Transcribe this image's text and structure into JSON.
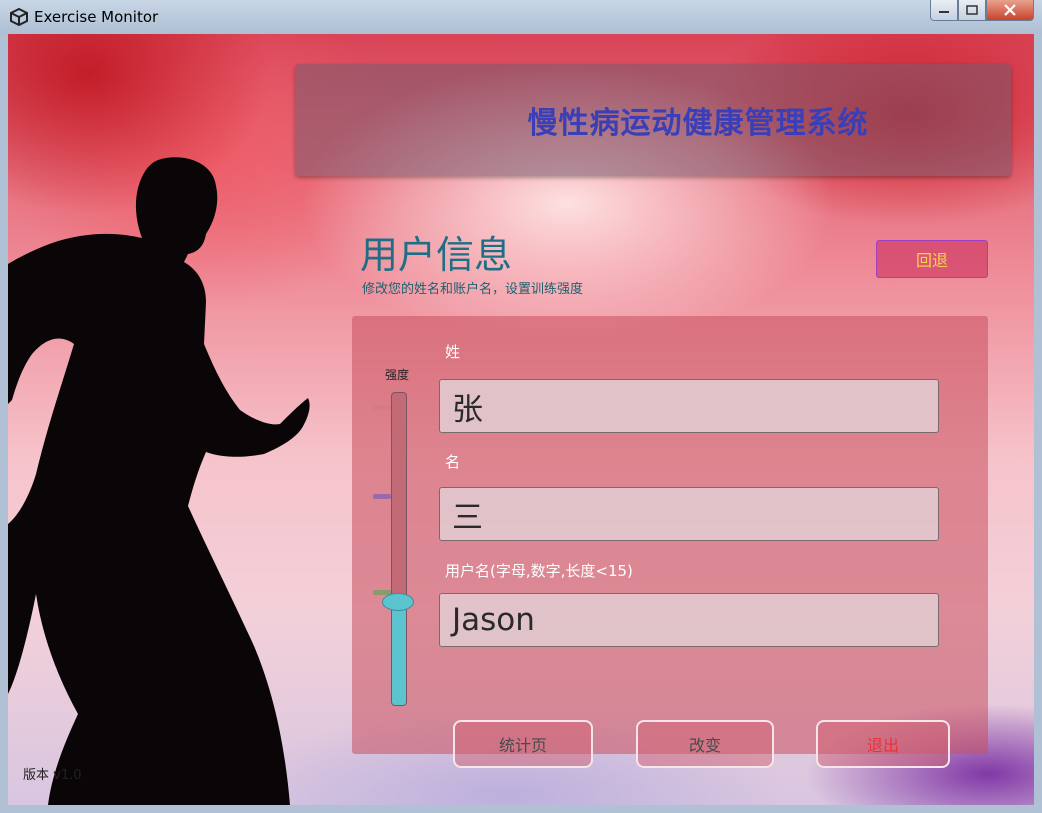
{
  "window": {
    "title": "Exercise Monitor",
    "controls": [
      "minimize-icon",
      "maximize-icon",
      "close-icon"
    ]
  },
  "banner": {
    "title": "慢性病运动健康管理系统"
  },
  "page": {
    "title": "用户信息",
    "subtitle": "修改您的姓名和账户名，设置训练强度",
    "back_label": "回退"
  },
  "form": {
    "last_name": {
      "label": "姓",
      "value": "张"
    },
    "first_name": {
      "label": "名",
      "value": "三"
    },
    "username": {
      "label": "用户名(字母,数字,长度<15)",
      "value": "Jason"
    }
  },
  "intensity": {
    "label": "强度",
    "level_fraction": 0.33,
    "tick_colors": [
      "#d77a86",
      "#9a6aa8",
      "#8a9a6a"
    ]
  },
  "actions": {
    "stats_label": "统计页",
    "change_label": "改变",
    "exit_label": "退出",
    "exit_color": "#e8323a"
  },
  "footer": {
    "version": "版本 v1.0"
  }
}
